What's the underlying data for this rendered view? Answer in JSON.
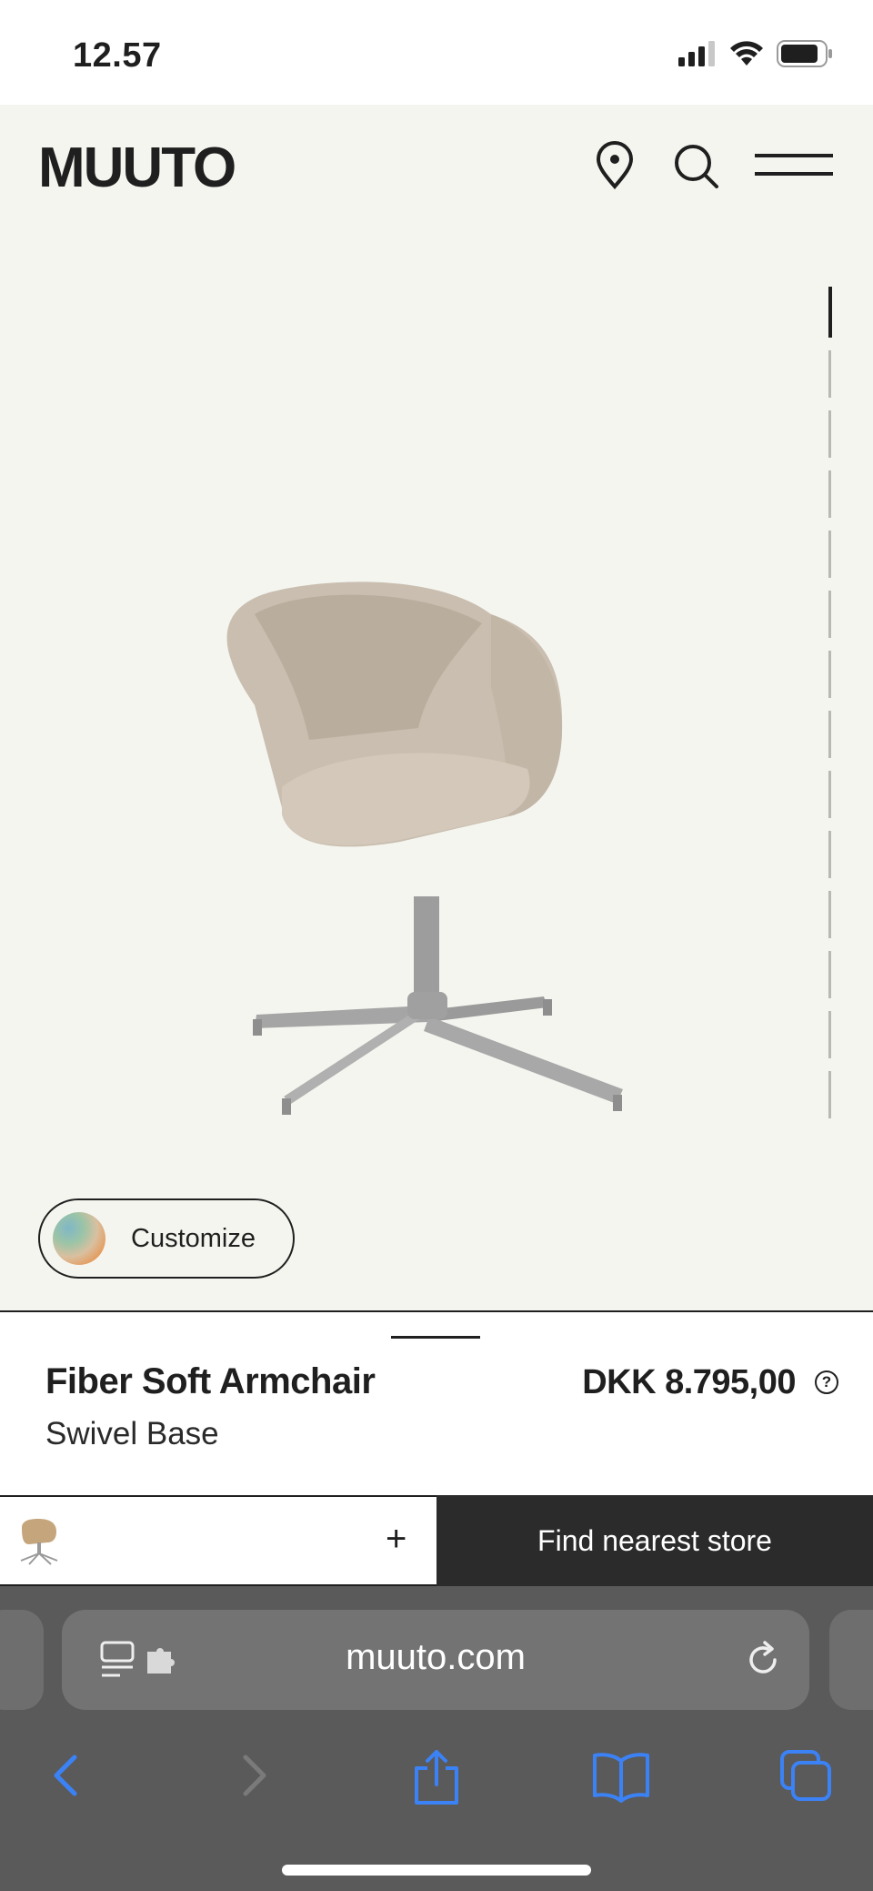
{
  "status_bar": {
    "time": "12.57"
  },
  "header": {
    "brand": "MUUTO"
  },
  "hero": {
    "customize_label": "Customize"
  },
  "product": {
    "name": "Fiber Soft Armchair",
    "subtitle": "Swivel Base",
    "price": "DKK 8.795,00",
    "help_symbol": "?"
  },
  "bottom_bar": {
    "add_symbol": "+",
    "store_button": "Find nearest store"
  },
  "browser": {
    "url": "muuto.com"
  },
  "colors": {
    "hero_bg": "#f5f5f0",
    "dark": "#2b2b2b",
    "safari_link": "#3b82f6"
  }
}
